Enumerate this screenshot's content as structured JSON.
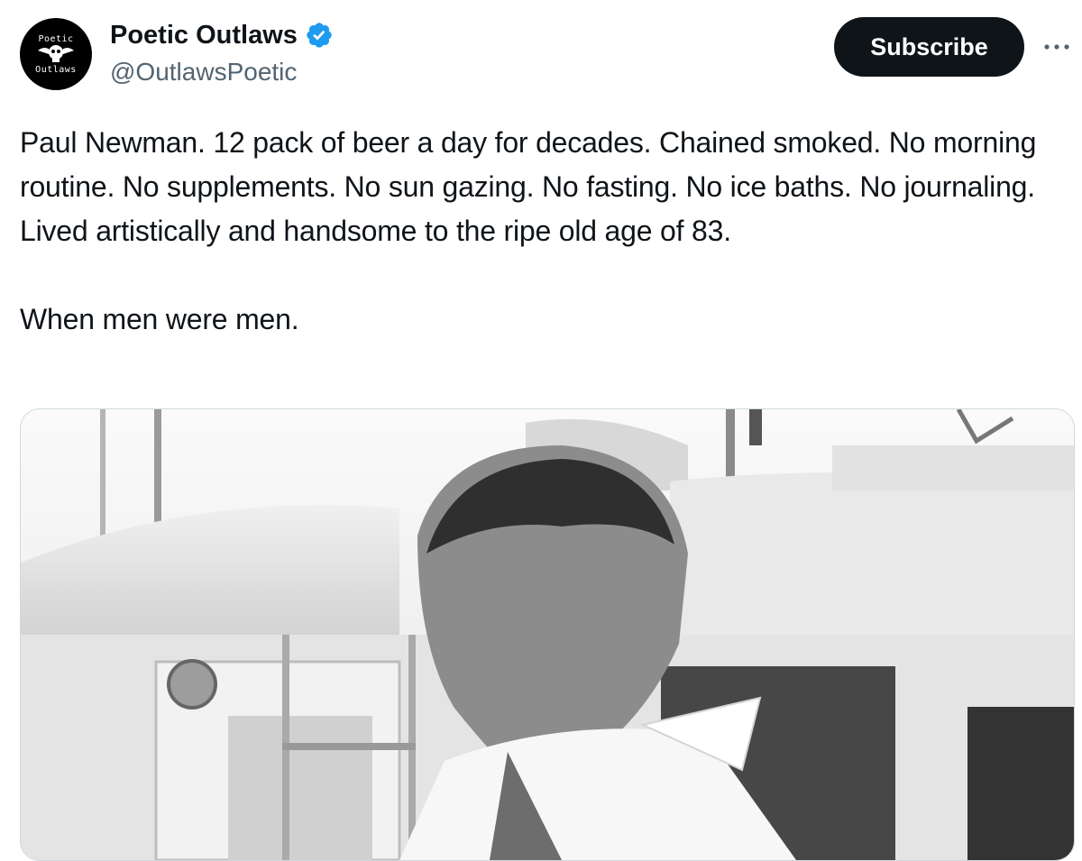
{
  "author": {
    "display_name": "Poetic Outlaws",
    "handle": "@OutlawsPoetic",
    "avatar": {
      "top_text": "Poetic",
      "bottom_text": "Outlaws",
      "icon": "winged-skull-icon"
    },
    "verified_icon": "verified-badge-icon"
  },
  "actions": {
    "subscribe_label": "Subscribe",
    "more_icon": "more-horizontal-icon"
  },
  "tweet": {
    "paragraphs": [
      "Paul Newman. 12 pack of beer a day for decades. Chained smoked. No morning routine. No supplements. No sun gazing. No fasting. No ice baths. No journaling. Lived artistically and handsome to the ripe old age of 83.",
      "When men were men."
    ]
  },
  "media": {
    "description_icon": "photo-image",
    "colors": {
      "border": "#cfd9de"
    }
  },
  "colors": {
    "text": "#0f1419",
    "secondary_text": "#536471",
    "verified": "#1d9bf0",
    "button_bg": "#0f1419"
  }
}
